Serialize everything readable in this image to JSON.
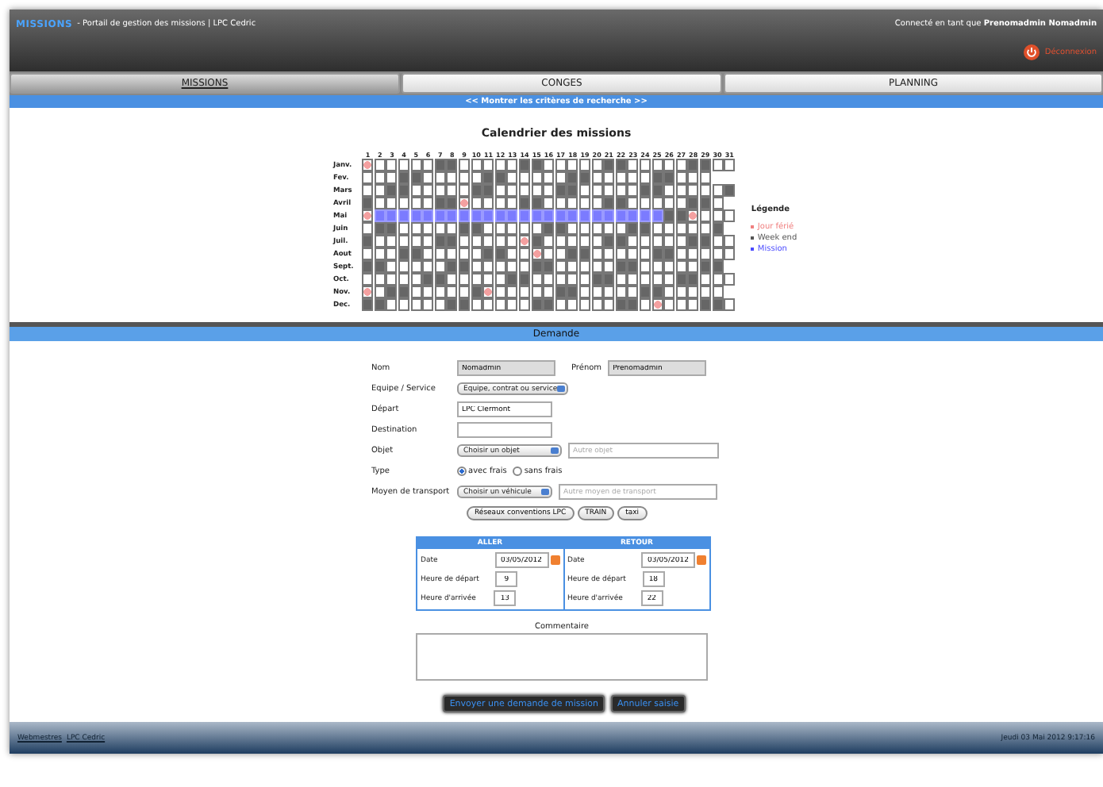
{
  "header": {
    "logo": "MISSIONS",
    "subtitle": "- Portail de gestion des missions | LPC Cedric",
    "user_prefix": "Connecté en tant que",
    "user_name": "Prenomadmin Nomadmin",
    "logout": "Déconnexion"
  },
  "tabs": [
    {
      "label": "MISSIONS",
      "selected": true
    },
    {
      "label": "CONGES",
      "selected": false
    },
    {
      "label": "PLANNING",
      "selected": false
    }
  ],
  "search_toggle": "<< Montrer les critères de recherche >>",
  "calendar": {
    "title": "Calendrier des missions",
    "day_numbers": [
      "1",
      "2",
      "3",
      "4",
      "5",
      "6",
      "7",
      "8",
      "9",
      "10",
      "11",
      "12",
      "13",
      "14",
      "15",
      "16",
      "17",
      "18",
      "19",
      "20",
      "21",
      "22",
      "23",
      "24",
      "25",
      "26",
      "27",
      "28",
      "29",
      "30",
      "31"
    ],
    "months": [
      {
        "label": "Janv.",
        "days": [
          {
            "kind": "holiday"
          },
          {
            "kind": "workday"
          },
          {
            "kind": "workday"
          },
          {
            "kind": "workday"
          },
          {
            "kind": "workday"
          },
          {
            "kind": "workday"
          },
          {
            "kind": "weekend"
          },
          {
            "kind": "weekend"
          },
          {
            "kind": "workday"
          },
          {
            "kind": "workday"
          },
          {
            "kind": "workday"
          },
          {
            "kind": "workday"
          },
          {
            "kind": "workday"
          },
          {
            "kind": "weekend"
          },
          {
            "kind": "weekend"
          },
          {
            "kind": "workday"
          },
          {
            "kind": "workday"
          },
          {
            "kind": "workday"
          },
          {
            "kind": "workday"
          },
          {
            "kind": "workday"
          },
          {
            "kind": "weekend"
          },
          {
            "kind": "weekend"
          },
          {
            "kind": "workday"
          },
          {
            "kind": "workday"
          },
          {
            "kind": "workday"
          },
          {
            "kind": "workday"
          },
          {
            "kind": "workday"
          },
          {
            "kind": "weekend"
          },
          {
            "kind": "weekend"
          },
          {
            "kind": "workday"
          },
          {
            "kind": "workday"
          }
        ]
      },
      {
        "label": "Fev.",
        "days": [
          {
            "kind": "workday"
          },
          {
            "kind": "workday"
          },
          {
            "kind": "workday"
          },
          {
            "kind": "weekend"
          },
          {
            "kind": "weekend"
          },
          {
            "kind": "workday"
          },
          {
            "kind": "workday"
          },
          {
            "kind": "workday"
          },
          {
            "kind": "workday"
          },
          {
            "kind": "workday"
          },
          {
            "kind": "weekend"
          },
          {
            "kind": "weekend"
          },
          {
            "kind": "workday"
          },
          {
            "kind": "workday"
          },
          {
            "kind": "workday"
          },
          {
            "kind": "workday"
          },
          {
            "kind": "workday"
          },
          {
            "kind": "weekend"
          },
          {
            "kind": "weekend"
          },
          {
            "kind": "workday"
          },
          {
            "kind": "workday"
          },
          {
            "kind": "workday"
          },
          {
            "kind": "workday"
          },
          {
            "kind": "workday"
          },
          {
            "kind": "weekend"
          },
          {
            "kind": "weekend"
          },
          {
            "kind": "workday"
          },
          {
            "kind": "workday"
          },
          {
            "kind": "workday"
          }
        ]
      },
      {
        "label": "Mars",
        "days": [
          {
            "kind": "workday"
          },
          {
            "kind": "workday"
          },
          {
            "kind": "weekend"
          },
          {
            "kind": "weekend"
          },
          {
            "kind": "workday"
          },
          {
            "kind": "workday"
          },
          {
            "kind": "workday"
          },
          {
            "kind": "workday"
          },
          {
            "kind": "workday"
          },
          {
            "kind": "weekend"
          },
          {
            "kind": "weekend"
          },
          {
            "kind": "workday"
          },
          {
            "kind": "workday"
          },
          {
            "kind": "workday"
          },
          {
            "kind": "workday"
          },
          {
            "kind": "workday"
          },
          {
            "kind": "weekend"
          },
          {
            "kind": "weekend"
          },
          {
            "kind": "workday"
          },
          {
            "kind": "workday"
          },
          {
            "kind": "workday"
          },
          {
            "kind": "workday"
          },
          {
            "kind": "workday"
          },
          {
            "kind": "weekend"
          },
          {
            "kind": "weekend"
          },
          {
            "kind": "workday"
          },
          {
            "kind": "workday"
          },
          {
            "kind": "workday"
          },
          {
            "kind": "workday"
          },
          {
            "kind": "workday"
          },
          {
            "kind": "weekend"
          }
        ]
      },
      {
        "label": "Avril",
        "days": [
          {
            "kind": "weekend"
          },
          {
            "kind": "workday"
          },
          {
            "kind": "workday"
          },
          {
            "kind": "workday"
          },
          {
            "kind": "workday"
          },
          {
            "kind": "workday"
          },
          {
            "kind": "weekend"
          },
          {
            "kind": "weekend"
          },
          {
            "kind": "holiday"
          },
          {
            "kind": "workday"
          },
          {
            "kind": "workday"
          },
          {
            "kind": "workday"
          },
          {
            "kind": "workday"
          },
          {
            "kind": "weekend"
          },
          {
            "kind": "weekend"
          },
          {
            "kind": "workday"
          },
          {
            "kind": "workday"
          },
          {
            "kind": "workday"
          },
          {
            "kind": "workday"
          },
          {
            "kind": "workday"
          },
          {
            "kind": "weekend"
          },
          {
            "kind": "weekend"
          },
          {
            "kind": "workday"
          },
          {
            "kind": "workday"
          },
          {
            "kind": "workday"
          },
          {
            "kind": "workday"
          },
          {
            "kind": "workday"
          },
          {
            "kind": "weekend"
          },
          {
            "kind": "weekend"
          },
          {
            "kind": "workday"
          }
        ]
      },
      {
        "label": "Mai",
        "days": [
          {
            "kind": "holiday"
          },
          {
            "kind": "mission"
          },
          {
            "kind": "mission"
          },
          {
            "kind": "mission"
          },
          {
            "kind": "mission"
          },
          {
            "kind": "mission"
          },
          {
            "kind": "mission"
          },
          {
            "kind": "mission"
          },
          {
            "kind": "mission"
          },
          {
            "kind": "mission"
          },
          {
            "kind": "mission"
          },
          {
            "kind": "mission"
          },
          {
            "kind": "mission"
          },
          {
            "kind": "mission"
          },
          {
            "kind": "mission"
          },
          {
            "kind": "mission"
          },
          {
            "kind": "mission"
          },
          {
            "kind": "mission"
          },
          {
            "kind": "mission"
          },
          {
            "kind": "mission"
          },
          {
            "kind": "mission"
          },
          {
            "kind": "mission"
          },
          {
            "kind": "mission"
          },
          {
            "kind": "mission"
          },
          {
            "kind": "mission"
          },
          {
            "kind": "weekend"
          },
          {
            "kind": "weekend"
          },
          {
            "kind": "holiday"
          },
          {
            "kind": "workday"
          },
          {
            "kind": "workday"
          },
          {
            "kind": "workday"
          }
        ]
      },
      {
        "label": "Juin",
        "days": [
          {
            "kind": "workday"
          },
          {
            "kind": "weekend"
          },
          {
            "kind": "weekend"
          },
          {
            "kind": "workday"
          },
          {
            "kind": "workday"
          },
          {
            "kind": "workday"
          },
          {
            "kind": "workday"
          },
          {
            "kind": "workday"
          },
          {
            "kind": "weekend"
          },
          {
            "kind": "weekend"
          },
          {
            "kind": "workday"
          },
          {
            "kind": "workday"
          },
          {
            "kind": "workday"
          },
          {
            "kind": "workday"
          },
          {
            "kind": "workday"
          },
          {
            "kind": "weekend"
          },
          {
            "kind": "weekend"
          },
          {
            "kind": "workday"
          },
          {
            "kind": "workday"
          },
          {
            "kind": "workday"
          },
          {
            "kind": "workday"
          },
          {
            "kind": "workday"
          },
          {
            "kind": "weekend"
          },
          {
            "kind": "weekend"
          },
          {
            "kind": "workday"
          },
          {
            "kind": "workday"
          },
          {
            "kind": "workday"
          },
          {
            "kind": "workday"
          },
          {
            "kind": "workday"
          },
          {
            "kind": "weekend"
          }
        ]
      },
      {
        "label": "Juil.",
        "days": [
          {
            "kind": "weekend"
          },
          {
            "kind": "workday"
          },
          {
            "kind": "workday"
          },
          {
            "kind": "workday"
          },
          {
            "kind": "workday"
          },
          {
            "kind": "workday"
          },
          {
            "kind": "weekend"
          },
          {
            "kind": "weekend"
          },
          {
            "kind": "workday"
          },
          {
            "kind": "workday"
          },
          {
            "kind": "workday"
          },
          {
            "kind": "workday"
          },
          {
            "kind": "workday"
          },
          {
            "kind": "holiday"
          },
          {
            "kind": "weekend"
          },
          {
            "kind": "workday"
          },
          {
            "kind": "workday"
          },
          {
            "kind": "workday"
          },
          {
            "kind": "workday"
          },
          {
            "kind": "workday"
          },
          {
            "kind": "weekend"
          },
          {
            "kind": "weekend"
          },
          {
            "kind": "workday"
          },
          {
            "kind": "workday"
          },
          {
            "kind": "workday"
          },
          {
            "kind": "workday"
          },
          {
            "kind": "workday"
          },
          {
            "kind": "weekend"
          },
          {
            "kind": "weekend"
          },
          {
            "kind": "workday"
          },
          {
            "kind": "workday"
          }
        ]
      },
      {
        "label": "Aout",
        "days": [
          {
            "kind": "workday"
          },
          {
            "kind": "workday"
          },
          {
            "kind": "workday"
          },
          {
            "kind": "weekend"
          },
          {
            "kind": "weekend"
          },
          {
            "kind": "workday"
          },
          {
            "kind": "workday"
          },
          {
            "kind": "workday"
          },
          {
            "kind": "workday"
          },
          {
            "kind": "workday"
          },
          {
            "kind": "weekend"
          },
          {
            "kind": "weekend"
          },
          {
            "kind": "workday"
          },
          {
            "kind": "workday"
          },
          {
            "kind": "holiday"
          },
          {
            "kind": "workday"
          },
          {
            "kind": "workday"
          },
          {
            "kind": "weekend"
          },
          {
            "kind": "weekend"
          },
          {
            "kind": "workday"
          },
          {
            "kind": "workday"
          },
          {
            "kind": "workday"
          },
          {
            "kind": "workday"
          },
          {
            "kind": "workday"
          },
          {
            "kind": "weekend"
          },
          {
            "kind": "weekend"
          },
          {
            "kind": "workday"
          },
          {
            "kind": "workday"
          },
          {
            "kind": "workday"
          },
          {
            "kind": "workday"
          },
          {
            "kind": "workday"
          }
        ]
      },
      {
        "label": "Sept.",
        "days": [
          {
            "kind": "weekend"
          },
          {
            "kind": "weekend"
          },
          {
            "kind": "workday"
          },
          {
            "kind": "workday"
          },
          {
            "kind": "workday"
          },
          {
            "kind": "workday"
          },
          {
            "kind": "workday"
          },
          {
            "kind": "weekend"
          },
          {
            "kind": "weekend"
          },
          {
            "kind": "workday"
          },
          {
            "kind": "workday"
          },
          {
            "kind": "workday"
          },
          {
            "kind": "workday"
          },
          {
            "kind": "workday"
          },
          {
            "kind": "weekend"
          },
          {
            "kind": "weekend"
          },
          {
            "kind": "workday"
          },
          {
            "kind": "workday"
          },
          {
            "kind": "workday"
          },
          {
            "kind": "workday"
          },
          {
            "kind": "workday"
          },
          {
            "kind": "weekend"
          },
          {
            "kind": "weekend"
          },
          {
            "kind": "workday"
          },
          {
            "kind": "workday"
          },
          {
            "kind": "workday"
          },
          {
            "kind": "workday"
          },
          {
            "kind": "workday"
          },
          {
            "kind": "weekend"
          },
          {
            "kind": "weekend"
          }
        ]
      },
      {
        "label": "Oct.",
        "days": [
          {
            "kind": "workday"
          },
          {
            "kind": "workday"
          },
          {
            "kind": "workday"
          },
          {
            "kind": "workday"
          },
          {
            "kind": "workday"
          },
          {
            "kind": "weekend"
          },
          {
            "kind": "weekend"
          },
          {
            "kind": "workday"
          },
          {
            "kind": "workday"
          },
          {
            "kind": "workday"
          },
          {
            "kind": "workday"
          },
          {
            "kind": "workday"
          },
          {
            "kind": "weekend"
          },
          {
            "kind": "weekend"
          },
          {
            "kind": "workday"
          },
          {
            "kind": "workday"
          },
          {
            "kind": "workday"
          },
          {
            "kind": "workday"
          },
          {
            "kind": "workday"
          },
          {
            "kind": "weekend"
          },
          {
            "kind": "weekend"
          },
          {
            "kind": "workday"
          },
          {
            "kind": "workday"
          },
          {
            "kind": "workday"
          },
          {
            "kind": "workday"
          },
          {
            "kind": "workday"
          },
          {
            "kind": "weekend"
          },
          {
            "kind": "weekend"
          },
          {
            "kind": "workday"
          },
          {
            "kind": "workday"
          },
          {
            "kind": "workday"
          }
        ]
      },
      {
        "label": "Nov.",
        "days": [
          {
            "kind": "holiday"
          },
          {
            "kind": "workday"
          },
          {
            "kind": "weekend"
          },
          {
            "kind": "weekend"
          },
          {
            "kind": "workday"
          },
          {
            "kind": "workday"
          },
          {
            "kind": "workday"
          },
          {
            "kind": "workday"
          },
          {
            "kind": "workday"
          },
          {
            "kind": "weekend"
          },
          {
            "kind": "holiday"
          },
          {
            "kind": "workday"
          },
          {
            "kind": "workday"
          },
          {
            "kind": "workday"
          },
          {
            "kind": "workday"
          },
          {
            "kind": "workday"
          },
          {
            "kind": "weekend"
          },
          {
            "kind": "weekend"
          },
          {
            "kind": "workday"
          },
          {
            "kind": "workday"
          },
          {
            "kind": "workday"
          },
          {
            "kind": "workday"
          },
          {
            "kind": "workday"
          },
          {
            "kind": "weekend"
          },
          {
            "kind": "weekend"
          },
          {
            "kind": "workday"
          },
          {
            "kind": "workday"
          },
          {
            "kind": "workday"
          },
          {
            "kind": "workday"
          },
          {
            "kind": "workday"
          }
        ]
      },
      {
        "label": "Dec.",
        "days": [
          {
            "kind": "weekend"
          },
          {
            "kind": "weekend"
          },
          {
            "kind": "workday"
          },
          {
            "kind": "workday"
          },
          {
            "kind": "workday"
          },
          {
            "kind": "workday"
          },
          {
            "kind": "workday"
          },
          {
            "kind": "weekend"
          },
          {
            "kind": "weekend"
          },
          {
            "kind": "workday"
          },
          {
            "kind": "workday"
          },
          {
            "kind": "workday"
          },
          {
            "kind": "workday"
          },
          {
            "kind": "workday"
          },
          {
            "kind": "weekend"
          },
          {
            "kind": "weekend"
          },
          {
            "kind": "workday"
          },
          {
            "kind": "workday"
          },
          {
            "kind": "workday"
          },
          {
            "kind": "workday"
          },
          {
            "kind": "workday"
          },
          {
            "kind": "weekend"
          },
          {
            "kind": "weekend"
          },
          {
            "kind": "workday"
          },
          {
            "kind": "holiday"
          },
          {
            "kind": "workday"
          },
          {
            "kind": "workday"
          },
          {
            "kind": "workday"
          },
          {
            "kind": "weekend"
          },
          {
            "kind": "weekend"
          },
          {
            "kind": "workday"
          }
        ]
      }
    ],
    "legend": {
      "title": "Légende",
      "items": [
        {
          "label": "Jour férié",
          "color": "#f08080"
        },
        {
          "label": "Week end",
          "color": "#555555"
        },
        {
          "label": "Mission",
          "color": "#4a4aff"
        }
      ]
    }
  },
  "form": {
    "title": "Demande",
    "nom_label": "Nom",
    "nom": "Nomadmin",
    "prenom_label": "Prénom",
    "prenom": "Prenomadmin",
    "equipe_label": "Equipe / Service",
    "equipe": "Equipe, contrat ou service",
    "depart_label": "Départ",
    "depart": "LPC Clermont",
    "destination_label": "Destination",
    "objet_label": "Objet",
    "objet": "Choisir un objet",
    "objet_other_placeholder": "Autre objet",
    "type_label": "Type",
    "type_options": [
      {
        "label": "avec frais",
        "selected": true
      },
      {
        "label": "sans frais",
        "selected": false
      }
    ],
    "transport_label": "Moyen de transport",
    "transport": "Choisir un véhicule",
    "transport_other_placeholder": "Autre moyen de transport",
    "action_buttons": [
      "Réseaux conventions LPC",
      "TRAIN",
      "taxi"
    ]
  },
  "schedule": [
    {
      "title": "ALLER",
      "date_label": "Date",
      "date": "03/05/2012",
      "depart_label": "Heure de départ",
      "depart": "9",
      "arrivee_label": "Heure d'arrivée",
      "arrivee": "13"
    },
    {
      "title": "RETOUR",
      "date_label": "Date",
      "date": "03/05/2012",
      "depart_label": "Heure de départ",
      "depart": "18",
      "arrivee_label": "Heure d'arrivée",
      "arrivee": "22"
    }
  ],
  "comment_label": "Commentaire",
  "buttons": [
    "Envoyer une demande de mission",
    "Annuler saisie"
  ],
  "footer": {
    "links": [
      "Webmestres",
      "LPC Cedric"
    ],
    "datetime": "Jeudi 03 Mai 2012  9:17:16"
  }
}
